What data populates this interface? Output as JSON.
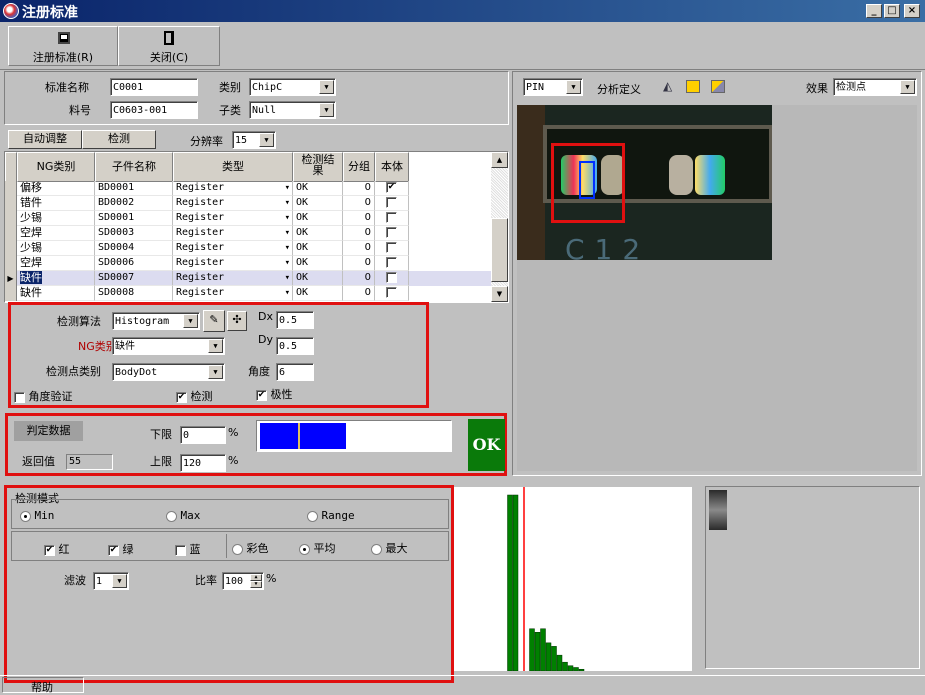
{
  "window": {
    "title": "注册标准",
    "min": "_",
    "max": "□",
    "close": "×"
  },
  "toolbar": {
    "register_label": "注册标准(R)",
    "close_label": "关闭(C)"
  },
  "form": {
    "name_label": "标准名称",
    "name_value": "C0001",
    "category_label": "类别",
    "category_value": "ChipC",
    "part_label": "料号",
    "part_value": "C0603-001",
    "subcategory_label": "子类",
    "subcategory_value": "Null"
  },
  "grid_toolbar": {
    "auto_adjust": "自动调整",
    "detect": "检测",
    "resolution_label": "分辨率",
    "resolution_value": "15"
  },
  "table": {
    "headers": [
      "NG类别",
      "子件名称",
      "类型",
      "检测结果",
      "分组",
      "本体"
    ],
    "rows": [
      {
        "ng": "偏移",
        "name": "BD0001",
        "type": "Register",
        "result": "OK",
        "group": "0",
        "body": true,
        "selected": false
      },
      {
        "ng": "错件",
        "name": "BD0002",
        "type": "Register",
        "result": "OK",
        "group": "0",
        "body": false,
        "selected": false
      },
      {
        "ng": "少锡",
        "name": "SD0001",
        "type": "Register",
        "result": "OK",
        "group": "0",
        "body": false,
        "selected": false
      },
      {
        "ng": "空焊",
        "name": "SD0003",
        "type": "Register",
        "result": "OK",
        "group": "0",
        "body": false,
        "selected": false
      },
      {
        "ng": "少锡",
        "name": "SD0004",
        "type": "Register",
        "result": "OK",
        "group": "0",
        "body": false,
        "selected": false
      },
      {
        "ng": "空焊",
        "name": "SD0006",
        "type": "Register",
        "result": "OK",
        "group": "0",
        "body": false,
        "selected": false
      },
      {
        "ng": "缺件",
        "name": "SD0007",
        "type": "Register",
        "result": "OK",
        "group": "0",
        "body": false,
        "selected": true
      },
      {
        "ng": "缺件",
        "name": "SD0008",
        "type": "Register",
        "result": "OK",
        "group": "0",
        "body": false,
        "selected": false
      }
    ]
  },
  "algo": {
    "algo_label": "检测算法",
    "algo_value": "Histogram",
    "ng_label": "NG类别",
    "ng_value": "缺件",
    "point_label": "检测点类别",
    "point_value": "BodyDot",
    "dx_label": "Dx",
    "dx_value": "0.5",
    "dy_label": "Dy",
    "dy_value": "0.5",
    "angle_label": "角度",
    "angle_value": "6",
    "angle_verify_label": "角度验证",
    "angle_verify": false,
    "detect_label": "检测",
    "detect": true,
    "polarity_label": "极性",
    "polarity": true
  },
  "judge": {
    "title": "判定数据",
    "return_label": "返回值",
    "return_value": "55",
    "lower_label": "下限",
    "lower_value": "0",
    "upper_label": "上限",
    "upper_value": "120",
    "pct": "%",
    "result": "OK"
  },
  "image_panel": {
    "pin_value": "PIN",
    "analysis_label": "分析定义",
    "effect_label": "效果",
    "effect_value": "检测点"
  },
  "mode": {
    "title": "检测模式",
    "min": "Min",
    "max": "Max",
    "range": "Range",
    "selected": "Min",
    "red": "红",
    "green": "绿",
    "blue": "蓝",
    "red_on": true,
    "green_on": true,
    "blue_on": false,
    "color": "彩色",
    "average": "平均",
    "maximum": "最大",
    "color_mode": "平均",
    "filter_label": "滤波",
    "filter_value": "1",
    "ratio_label": "比率",
    "ratio_value": "100",
    "pct": "%"
  },
  "histogram": {
    "values": [
      0,
      0,
      0,
      0,
      0,
      0,
      0,
      0,
      0,
      100,
      100,
      0,
      0,
      24,
      22,
      24,
      16,
      14,
      9,
      5,
      3,
      2,
      1,
      0,
      0,
      0,
      0,
      0,
      0,
      0
    ],
    "threshold_index": 12,
    "bar_color": "#008000",
    "line_color": "#ff0000"
  },
  "statusbar": {
    "help": "帮助"
  },
  "colors": {
    "titlebar": "#0a246a",
    "ok": "#0a7a0a",
    "accent_red": "#e01010"
  }
}
